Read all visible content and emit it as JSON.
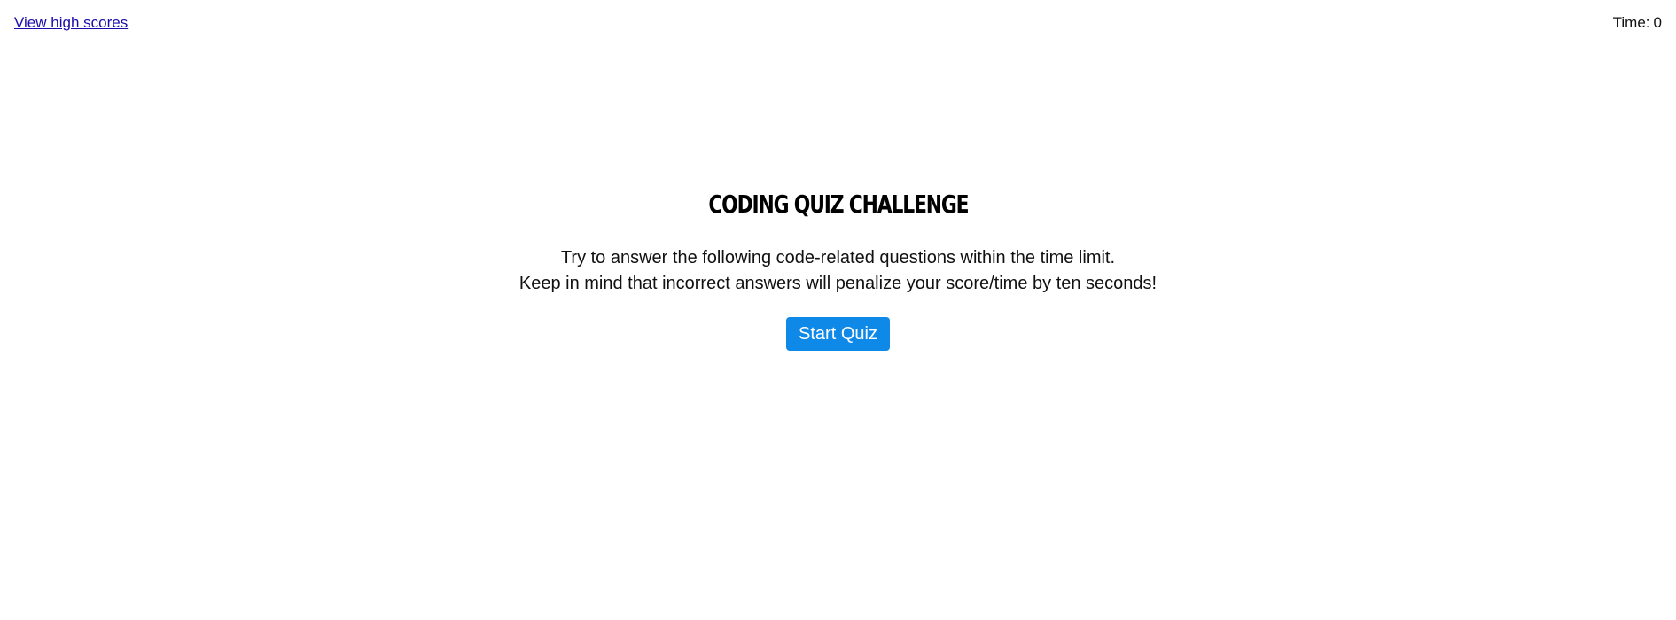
{
  "header": {
    "high_scores_link": "View high scores",
    "timer_label": "Time:",
    "timer_value": "0"
  },
  "main": {
    "title": "Coding Quiz Challenge",
    "intro_line_1": "Try to answer the following code-related questions within the time limit.",
    "intro_line_2": "Keep in mind that incorrect answers will penalize your score/time by ten seconds!",
    "start_button": "Start Quiz"
  },
  "colors": {
    "link": "#1a0dab",
    "button_bg": "#0f89e8",
    "button_text": "#ffffff",
    "text": "#111111"
  }
}
